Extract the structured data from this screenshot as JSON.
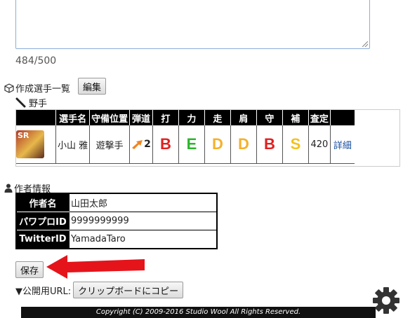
{
  "comment_box": {
    "counter": "484/500"
  },
  "players_section": {
    "title": "作成選手一覧",
    "edit_button": "編集",
    "subsection": "野手",
    "headers": [
      "選手名",
      "守備位置",
      "弾道",
      "打",
      "力",
      "走",
      "肩",
      "守",
      "補",
      "査定"
    ],
    "rows": [
      {
        "badge": "SR",
        "name": "小山 雅",
        "position": "遊撃手",
        "trajectory": "2",
        "grades": [
          "B",
          "E",
          "D",
          "D",
          "B",
          "S"
        ],
        "rating": "420",
        "detail": "詳細"
      }
    ],
    "grade_colors": {
      "B": "#e02020",
      "E": "#2db52d",
      "D": "#f5b12a",
      "S": "#f3c21c"
    }
  },
  "author_section": {
    "title": "作者情報",
    "rows": [
      {
        "label": "作者名",
        "value": "山田太郎"
      },
      {
        "label": "パワプロID",
        "value": "9999999999"
      },
      {
        "label": "TwitterID",
        "value": "YamadaTaro"
      }
    ]
  },
  "save_button": "保存",
  "public_url": {
    "label": "▼公開用URL:",
    "copy_button": "クリップボードにコピー"
  },
  "footer": "Copyright (C) 2009-2016 Studio Wool All Rights Reserved.",
  "icons": {
    "cube": "cube-icon",
    "bat": "bat-icon",
    "person": "person-icon",
    "gear": "gear-icon",
    "arrow": "red-arrow"
  },
  "colors": {
    "arrow": "#e5141b",
    "link": "#1a4fa0"
  }
}
